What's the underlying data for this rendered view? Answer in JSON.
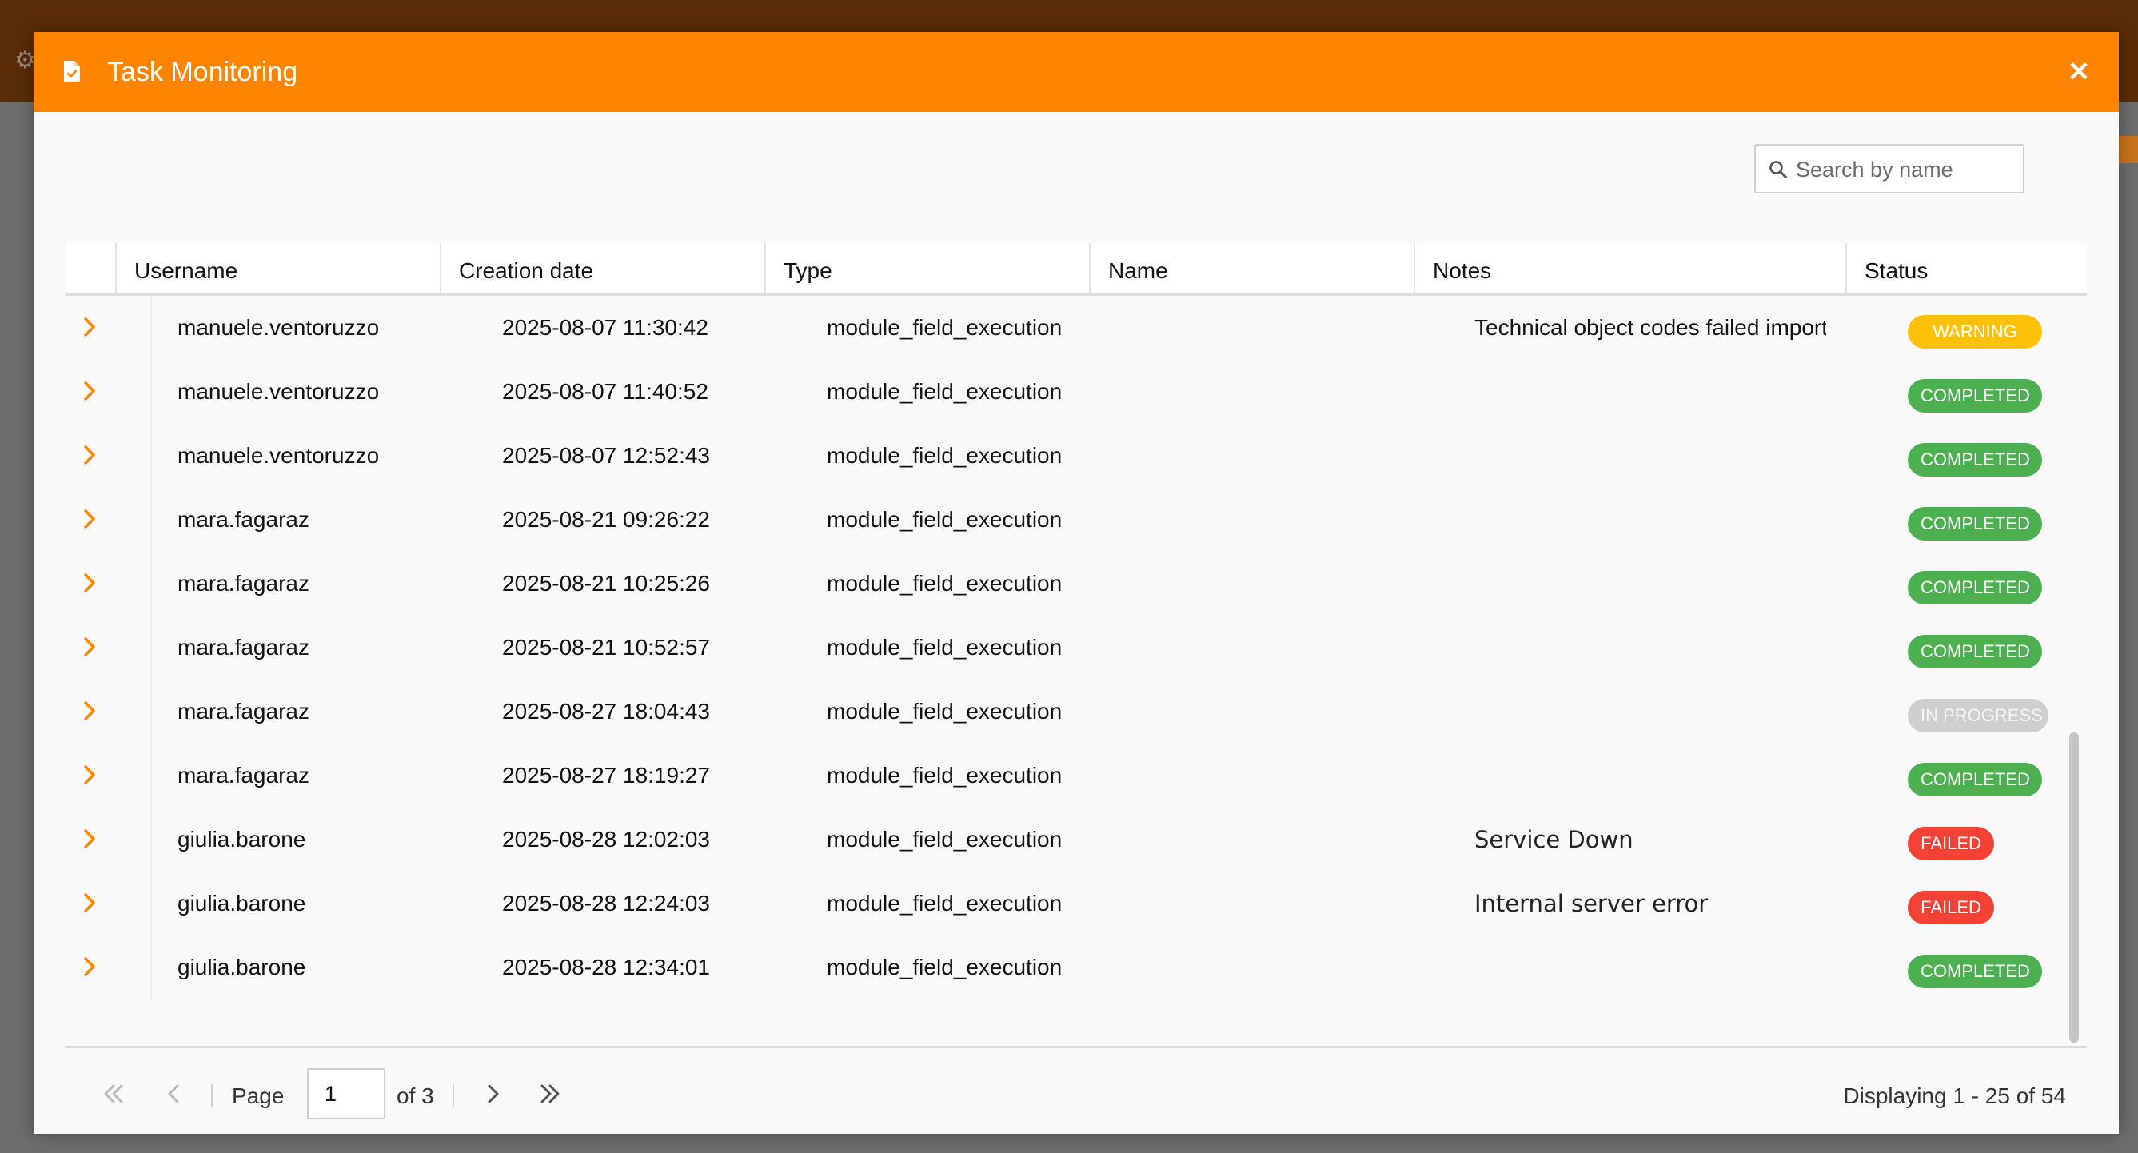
{
  "modal": {
    "title": "Task Monitoring",
    "close_glyph": "✕",
    "header_color": "#ff8400"
  },
  "search": {
    "placeholder": "Search by name"
  },
  "grid": {
    "columns": [
      {
        "key": "username",
        "label": "Username"
      },
      {
        "key": "creation_date",
        "label": "Creation date"
      },
      {
        "key": "type",
        "label": "Type"
      },
      {
        "key": "name",
        "label": "Name"
      },
      {
        "key": "notes",
        "label": "Notes"
      },
      {
        "key": "status",
        "label": "Status"
      }
    ],
    "rows": [
      {
        "username": "manuele.ventoruzzo",
        "creation_date": "2025-08-07 11:30:42",
        "type": "module_field_execution",
        "name": "",
        "notes": "Technical object codes failed import…",
        "status": "WARNING"
      },
      {
        "username": "manuele.ventoruzzo",
        "creation_date": "2025-08-07 11:40:52",
        "type": "module_field_execution",
        "name": "",
        "notes": "",
        "status": "COMPLETED"
      },
      {
        "username": "manuele.ventoruzzo",
        "creation_date": "2025-08-07 12:52:43",
        "type": "module_field_execution",
        "name": "",
        "notes": "",
        "status": "COMPLETED"
      },
      {
        "username": "mara.fagaraz",
        "creation_date": "2025-08-21 09:26:22",
        "type": "module_field_execution",
        "name": "",
        "notes": "",
        "status": "COMPLETED"
      },
      {
        "username": "mara.fagaraz",
        "creation_date": "2025-08-21 10:25:26",
        "type": "module_field_execution",
        "name": "",
        "notes": "",
        "status": "COMPLETED"
      },
      {
        "username": "mara.fagaraz",
        "creation_date": "2025-08-21 10:52:57",
        "type": "module_field_execution",
        "name": "",
        "notes": "",
        "status": "COMPLETED"
      },
      {
        "username": "mara.fagaraz",
        "creation_date": "2025-08-27 18:04:43",
        "type": "module_field_execution",
        "name": "",
        "notes": "",
        "status": "IN PROGRESS"
      },
      {
        "username": "mara.fagaraz",
        "creation_date": "2025-08-27 18:19:27",
        "type": "module_field_execution",
        "name": "",
        "notes": "",
        "status": "COMPLETED"
      },
      {
        "username": "giulia.barone",
        "creation_date": "2025-08-28 12:02:03",
        "type": "module_field_execution",
        "name": "",
        "notes": "Service Down",
        "status": "FAILED"
      },
      {
        "username": "giulia.barone",
        "creation_date": "2025-08-28 12:24:03",
        "type": "module_field_execution",
        "name": "",
        "notes": "Internal server error",
        "status": "FAILED"
      },
      {
        "username": "giulia.barone",
        "creation_date": "2025-08-28 12:34:01",
        "type": "module_field_execution",
        "name": "",
        "notes": "",
        "status": "COMPLETED"
      }
    ]
  },
  "status_colors": {
    "WARNING": "#ffc107",
    "COMPLETED": "#4caf50",
    "IN PROGRESS": "#cfcfcf",
    "FAILED": "#f44336"
  },
  "pager": {
    "page_label": "Page",
    "current_page": "1",
    "of_label": "of 3",
    "displaying": "Displaying 1 - 25 of 54"
  },
  "icons": {
    "header": "document-check-icon",
    "close": "close-icon",
    "search": "search-icon",
    "expander": "chevron-right-icon",
    "first": "double-chevron-left-icon",
    "prev": "chevron-left-icon",
    "next": "chevron-right-icon",
    "last": "double-chevron-right-icon"
  }
}
